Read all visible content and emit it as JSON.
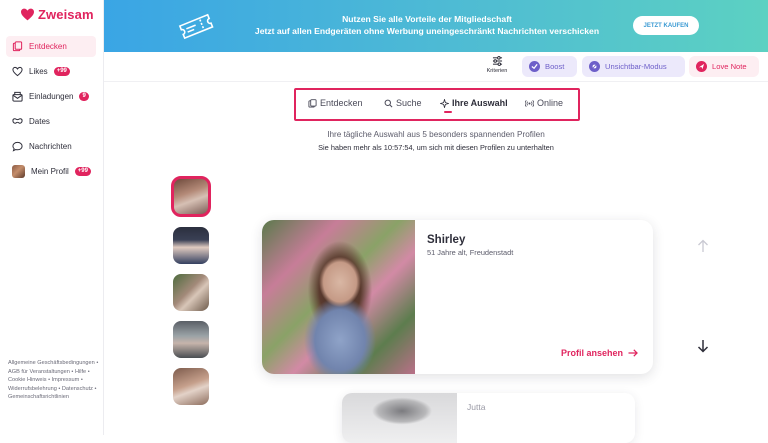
{
  "app": {
    "logo_text": "Zweisam",
    "brand_color": "#e0245e"
  },
  "sidebar": {
    "items": [
      {
        "label": "Entdecken",
        "icon": "cards-icon",
        "active": true,
        "badge": ""
      },
      {
        "label": "Likes",
        "icon": "heart-icon",
        "active": false,
        "badge": "+99"
      },
      {
        "label": "Einladungen",
        "icon": "invite-icon",
        "active": false,
        "badge": "9"
      },
      {
        "label": "Dates",
        "icon": "dates-icon",
        "active": false,
        "badge": ""
      },
      {
        "label": "Nachrichten",
        "icon": "chat-bubble-icon",
        "active": false,
        "badge": ""
      },
      {
        "label": "Mein Profil",
        "icon": "avatar",
        "active": false,
        "badge": "+99"
      }
    ],
    "footer_text": "Allgemeine Geschäftsbedingungen • AGB für Veranstaltungen • Hilfe • Cookie Hinweis • Impressum • Widerrufsbelehrung • Datenschutz • Gemeinschaftsrichtlinien"
  },
  "banner": {
    "title": "Nutzen Sie alle Vorteile der Mitgliedschaft",
    "subtitle": "Jetzt auf allen Endgeräten ohne Werbung uneingeschränkt Nachrichten verschicken",
    "button_label": "JETZT KAUFEN",
    "icon": "ticket-icon"
  },
  "toolbar": {
    "criteria_label": "Kriterien",
    "boost_label": "Boost",
    "invisible_label": "Unsichtbar-Modus",
    "lovenote_label": "Love Note"
  },
  "tabs": [
    {
      "label": "Entdecken",
      "icon": "cards-icon",
      "active": false
    },
    {
      "label": "Suche",
      "icon": "search-icon",
      "active": false
    },
    {
      "label": "Ihre Auswahl",
      "icon": "sparkle-icon",
      "active": true
    },
    {
      "label": "Online",
      "icon": "signal-icon",
      "active": false
    }
  ],
  "info": {
    "line1": "Ihre tägliche Auswahl aus 5 besonders spannenden Profilen",
    "line2": "Sie haben mehr als 10:57:54, um sich mit diesen Profilen zu unterhalten"
  },
  "profile": {
    "name": "Shirley",
    "details": "51 Jahre alt, Freudenstadt",
    "link_label": "Profil ansehen"
  },
  "next_profile": {
    "name": "Jutta"
  }
}
